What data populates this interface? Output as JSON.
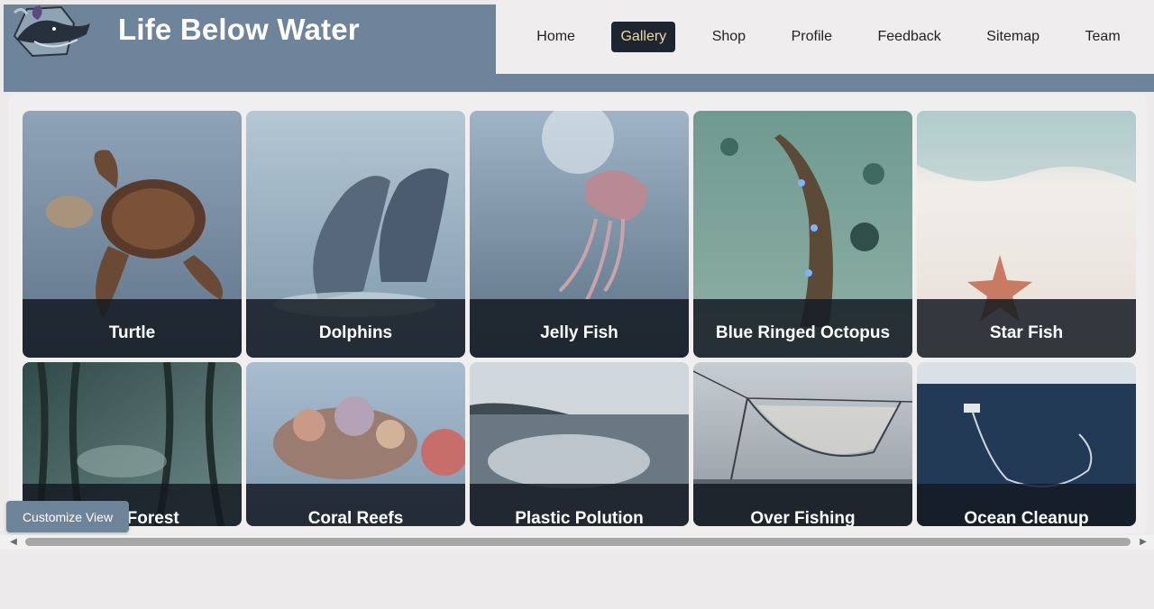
{
  "site": {
    "title": "Life Below Water",
    "logo_icon": "whale-logo-icon"
  },
  "nav": {
    "items": [
      {
        "label": "Home",
        "active": false
      },
      {
        "label": "Gallery",
        "active": true
      },
      {
        "label": "Shop",
        "active": false
      },
      {
        "label": "Profile",
        "active": false
      },
      {
        "label": "Feedback",
        "active": false
      },
      {
        "label": "Sitemap",
        "active": false
      },
      {
        "label": "Team",
        "active": false
      }
    ]
  },
  "gallery": {
    "items": [
      {
        "caption": "Turtle"
      },
      {
        "caption": "Dolphins"
      },
      {
        "caption": "Jelly Fish"
      },
      {
        "caption": "Blue Ringed Octopus"
      },
      {
        "caption": "Star Fish"
      },
      {
        "caption": "Kelp Forest"
      },
      {
        "caption": "Coral Reefs"
      },
      {
        "caption": "Plastic Polution"
      },
      {
        "caption": "Over Fishing"
      },
      {
        "caption": "Ocean Cleanup"
      }
    ]
  },
  "customize": {
    "label": "Customize View"
  },
  "colors": {
    "header": "#6e849b",
    "nav_active_bg": "#1c2530",
    "nav_active_text": "#f0d9a6"
  }
}
